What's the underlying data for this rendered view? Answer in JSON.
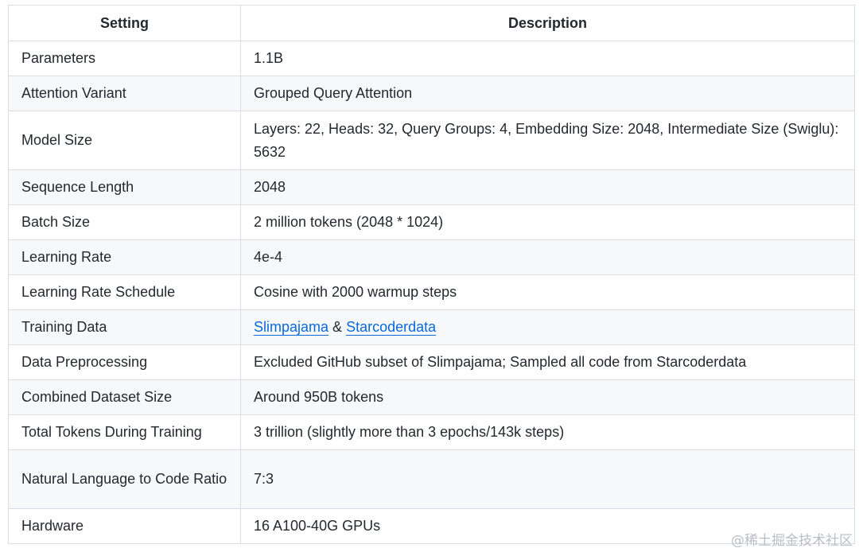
{
  "table": {
    "headers": [
      "Setting",
      "Description"
    ],
    "rows": [
      {
        "setting": "Parameters",
        "description": "1.1B"
      },
      {
        "setting": "Attention Variant",
        "description": "Grouped Query Attention"
      },
      {
        "setting": "Model Size",
        "description": "Layers: 22, Heads: 32, Query Groups: 4, Embedding Size: 2048, Intermediate Size (Swiglu): 5632"
      },
      {
        "setting": "Sequence Length",
        "description": "2048"
      },
      {
        "setting": "Batch Size",
        "description": "2 million tokens (2048 * 1024)"
      },
      {
        "setting": "Learning Rate",
        "description": "4e-4"
      },
      {
        "setting": "Learning Rate Schedule",
        "description": "Cosine with 2000 warmup steps"
      },
      {
        "setting": "Training Data",
        "link1": "Slimpajama",
        "separator": " & ",
        "link2": "Starcoderdata"
      },
      {
        "setting": "Data Preprocessing",
        "description": "Excluded GitHub subset of Slimpajama; Sampled all code from Starcoderdata"
      },
      {
        "setting": "Combined Dataset Size",
        "description": "Around 950B tokens"
      },
      {
        "setting": "Total Tokens During Training",
        "description": "3 trillion (slightly more than 3 epochs/143k steps)"
      },
      {
        "setting": "Natural Language to Code Ratio",
        "description": "7:3"
      },
      {
        "setting": "Hardware",
        "description": "16 A100-40G GPUs"
      }
    ]
  },
  "watermark": "@稀土掘金技术社区",
  "colors": {
    "link": "#0969da",
    "border": "#d8dee4",
    "stripe": "#f6f8fa",
    "text": "#24292f"
  }
}
